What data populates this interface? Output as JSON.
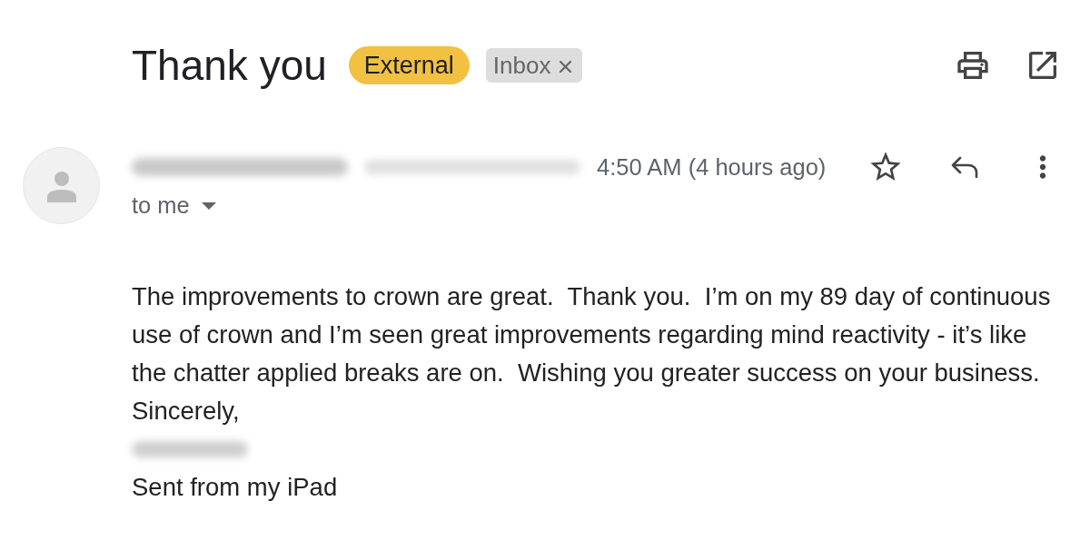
{
  "subject": "Thank you",
  "labels": [
    {
      "text": "External",
      "kind": "external",
      "removable": false
    },
    {
      "text": "Inbox",
      "kind": "folder",
      "removable": true
    }
  ],
  "message": {
    "time": "4:50 AM (4 hours ago)",
    "starred": false,
    "recipient": "to me",
    "body": [
      {
        "kind": "text",
        "text": "The improvements to crown are great.  Thank you.  I’m on my 89 day of continuous use of crown and I’m seen great improvements regarding mind reactivity - it’s like the chatter applied breaks are on.  Wishing you greater success on your business."
      },
      {
        "kind": "text",
        "text": "Sincerely,"
      },
      {
        "kind": "redacted"
      },
      {
        "kind": "text",
        "text": "Sent from my iPad"
      }
    ]
  }
}
